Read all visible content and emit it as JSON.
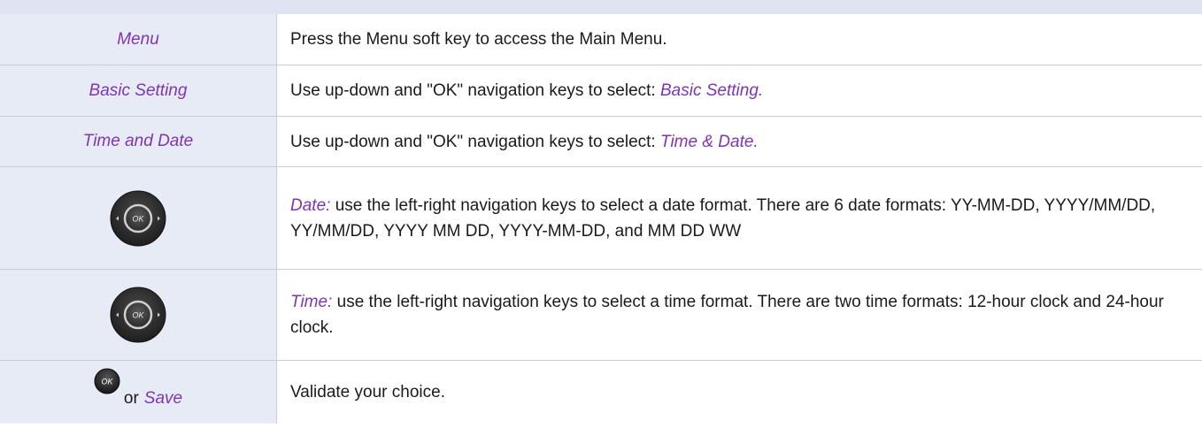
{
  "rows": [
    {
      "left": "Menu",
      "right_text": "Press the Menu soft key to access the Main Menu."
    },
    {
      "left": "Basic Setting",
      "right_prefix": "Use up-down and \"OK\" navigation keys to select: ",
      "right_em": "Basic Setting."
    },
    {
      "left": "Time and Date",
      "right_prefix": "Use up-down and \"OK\" navigation keys to select: ",
      "right_em": "Time & Date."
    },
    {
      "left_icon": "navigation-pad-icon",
      "right_em": "Date:",
      "right_text": " use the left-right navigation keys to select a date format. There are 6 date formats: YY-MM-DD, YYYY/MM/DD, YY/MM/DD, YYYY MM DD, YYYY-MM-DD, and MM DD WW"
    },
    {
      "left_icon": "navigation-pad-icon",
      "right_em": "Time:",
      "right_text": " use the left-right navigation keys to select a time format. There are two time formats: 12-hour clock and 24-hour clock."
    },
    {
      "left_icon": "ok-key-icon",
      "left_icon_label": "OK",
      "left_or": "or",
      "left_em": "Save",
      "right_text": "Validate your choice."
    }
  ],
  "nav_pad_label": "OK",
  "colors": {
    "accent_purple": "#7f35b3",
    "left_cell_bg": "#e6ebf5",
    "border": "#c9ced6",
    "key_dark": "#2b2b2b"
  }
}
